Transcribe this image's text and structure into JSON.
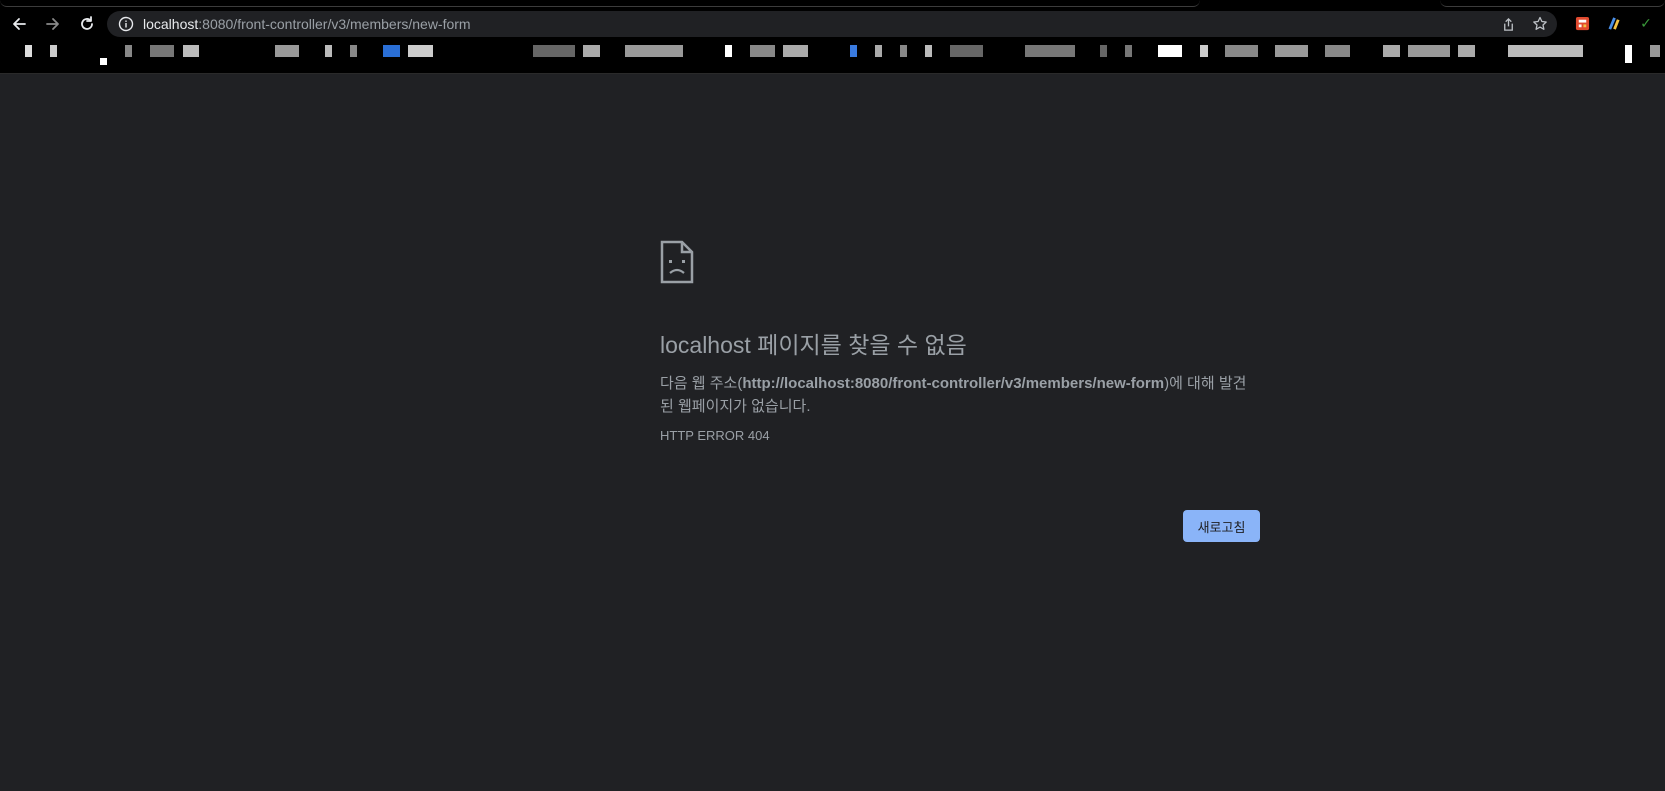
{
  "browser": {
    "address_bar": {
      "host": "localhost",
      "path": ":8080/front-controller/v3/members/new-form"
    },
    "icons": {
      "back": "back-arrow-icon",
      "forward": "forward-arrow-icon",
      "reload": "reload-icon",
      "info": "info-icon",
      "share": "share-icon",
      "bookmark": "star-icon"
    }
  },
  "error_page": {
    "title": "localhost 페이지를 찾을 수 없음",
    "description_prefix": "다음 웹 주소(",
    "description_url": "http://localhost:8080/front-controller/v3/members/new-form",
    "description_suffix": ")에 대해 발견된 웹페이지가 없습니다.",
    "error_code": "HTTP ERROR 404",
    "reload_label": "새로고침"
  },
  "colors": {
    "page_background": "#202124",
    "text": "#9aa0a6",
    "button": "#8ab4f8"
  }
}
